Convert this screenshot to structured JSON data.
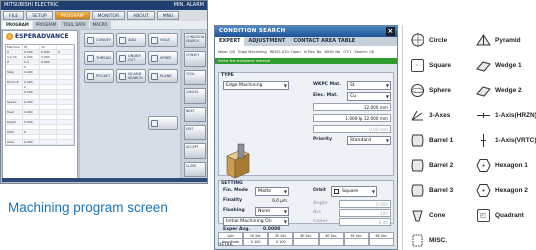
{
  "panel1": {
    "title": "MITSUBISHI ELECTRIC",
    "title_right": "MIN. ALARM",
    "menu": [
      "FILE",
      "SETUP",
      "PROGRAM",
      "MONITOR",
      "ABOUT",
      "MNU"
    ],
    "active_menu": "PROGRAM",
    "tabs": [
      "PROGRAM",
      "PROGRAM",
      "TOOL DATA",
      "MACRO"
    ],
    "logo": "ESPERADVANCE",
    "grid_rows": [
      [
        "Machine",
        "Pt",
        "10",
        ""
      ],
      [
        "0",
        "0.000",
        "0.000",
        "0"
      ],
      [
        "X-0.00",
        "0.000",
        "0.000",
        ""
      ],
      [
        "Z",
        "2.3",
        "0.000",
        ""
      ],
      [
        "",
        "0",
        "",
        ""
      ],
      [
        "Step",
        "0.000",
        "",
        ""
      ],
      [
        "",
        "",
        "",
        ""
      ],
      [
        "Finish Z",
        "0.000",
        "",
        ""
      ],
      [
        "",
        "0",
        "",
        ""
      ],
      [
        "",
        "0.000",
        "",
        ""
      ],
      [
        "",
        "",
        "",
        ""
      ],
      [
        "Speed",
        "0.000",
        "",
        ""
      ],
      [
        "",
        "",
        "",
        ""
      ],
      [
        "Feed",
        "0.000",
        "",
        ""
      ],
      [
        "",
        "",
        "",
        ""
      ],
      [
        "Depth",
        "0.000",
        "",
        ""
      ],
      [
        "",
        "",
        "",
        ""
      ],
      [
        "Pitch",
        "0",
        "",
        ""
      ],
      [
        "",
        "",
        "",
        ""
      ],
      [
        "Area",
        "0.000",
        "",
        ""
      ]
    ],
    "mid_buttons": [
      "CONVEY",
      "ADD",
      "HOLE",
      "THREAD",
      "UNDER CUT",
      "SPREE",
      "POCKET",
      "ISLAND SEARCH",
      "PLANE"
    ],
    "side_buttons": [
      "CONDITION SEARCH",
      "CONVEY",
      "TOOL",
      "CANCEL",
      "NEXT",
      "EDIT",
      "ACCEPT",
      "CLOSE"
    ],
    "caption": "Machining program screen"
  },
  "panel2": {
    "title": "CONDITION SEARCH",
    "close": "×",
    "tabs": [
      "EXPERT",
      "ADJUSTMENT",
      "CONTACT AREA TABLE"
    ],
    "subrow": [
      "Wipe: 0/0",
      "Edge Machining",
      "WH22-010: Open",
      "In Pos: No",
      "WH9: No",
      "OT:1",
      "Search: OK"
    ],
    "notice": "Select the workpiece material",
    "type_label": "TYPE",
    "type_value": "Edge Machining",
    "fields": [
      {
        "label": "WKPC Mat.",
        "value": "St",
        "dropdown": true
      },
      {
        "label": "Elec. Mat.",
        "value": "Cu",
        "dropdown": true
      },
      {
        "label": "Depth",
        "value": "12.000 mm",
        "dropdown": false
      },
      {
        "label": "Area",
        "value": "1.000  lp  12.000 mm",
        "dropdown": false
      },
      {
        "label": "Side Incr.",
        "value": "0.00 mm",
        "dropdown": false,
        "dim": true
      },
      {
        "label": "Priority",
        "value": "Standard",
        "dropdown": true
      }
    ],
    "setting_label": "SETTING",
    "settings": [
      {
        "label": "Fin. Mode",
        "value": "Matte"
      },
      {
        "label": "Finality",
        "value": "6.0 μm"
      },
      {
        "label": "Flushing",
        "value": "None"
      },
      {
        "label": "Initial Machining On",
        "value": ""
      },
      {
        "label": "Exper Avg.",
        "value": "0.0000"
      }
    ],
    "orbit_label": "Orbit",
    "orbit_value": "Square",
    "orbit_fields": [
      "Angle",
      "Arc",
      "Coner"
    ],
    "orbit_vals": [
      "0.000",
      "100",
      "0.00"
    ],
    "table_row1": [
      "Lph",
      "1E Ser.",
      "2E Ser.",
      "3E Ser.",
      "4E Ser.",
      "5E Ser.",
      "6E Ser."
    ],
    "table_row2": [
      "Amplitude",
      "0.100",
      "0.100",
      "",
      "",
      "",
      ""
    ],
    "footer": "DETAIL"
  },
  "panel3": {
    "shapes": [
      {
        "label": "Circle",
        "icon": "circle-orbit-icon"
      },
      {
        "label": "Pyramid",
        "icon": "pyramid-icon"
      },
      {
        "label": "Square",
        "icon": "square-orbit-icon"
      },
      {
        "label": "Wedge 1",
        "icon": "wedge-icon"
      },
      {
        "label": "Sphere",
        "icon": "sphere-icon"
      },
      {
        "label": "Wedge 2",
        "icon": "wedge-icon"
      },
      {
        "label": "3-Axes",
        "icon": "three-axes-icon"
      },
      {
        "label": "1-Axis(HRZN)",
        "icon": "axis-horizontal-icon"
      },
      {
        "label": "Barrel 1",
        "icon": "barrel-icon"
      },
      {
        "label": "1-Axis(VRTC)",
        "icon": "axis-vertical-icon"
      },
      {
        "label": "Barrel 2",
        "icon": "barrel-icon"
      },
      {
        "label": "Hexagon 1",
        "icon": "hexagon-icon"
      },
      {
        "label": "Barrel 3",
        "icon": "barrel-icon"
      },
      {
        "label": "Hexagon 2",
        "icon": "hexagon-icon"
      },
      {
        "label": "Cone",
        "icon": "cone-icon"
      },
      {
        "label": "Quadrant",
        "icon": "quadrant-icon"
      },
      {
        "label": "MISC.",
        "icon": "misc-icon"
      }
    ]
  },
  "colors": {
    "caption": "#1a73b8",
    "title_bar": "#1f3f70",
    "dialog_title": "#1c5495",
    "notice": "#2e9b2e",
    "active_menu": "#d17f14"
  }
}
